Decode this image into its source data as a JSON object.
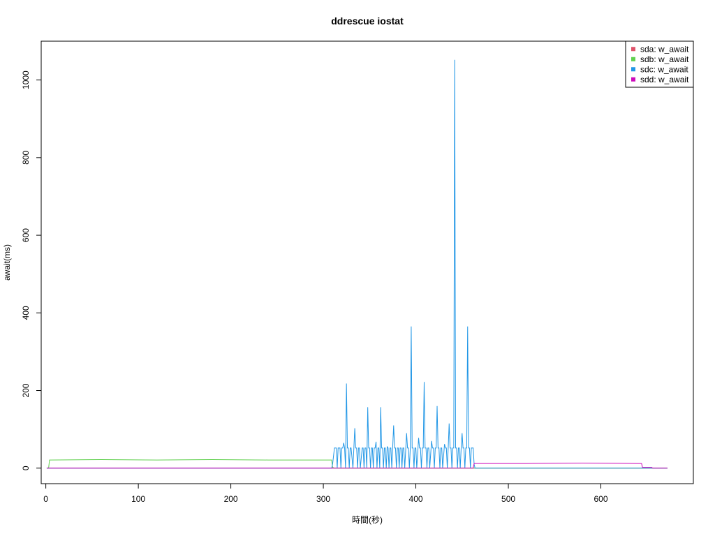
{
  "chart_data": {
    "type": "line",
    "title": "ddrescue iostat",
    "xlabel": "時間(秒)",
    "ylabel": "await(ms)",
    "xlim": [
      -5,
      700
    ],
    "ylim": [
      -40,
      1100
    ],
    "xticks": [
      0,
      100,
      200,
      300,
      400,
      500,
      600
    ],
    "yticks": [
      0,
      200,
      400,
      600,
      800,
      1000
    ],
    "grid": false,
    "legend_position": "top-right",
    "series": [
      {
        "name": "sda: w_await",
        "color": "#df536b",
        "points": [
          [
            1,
            0
          ],
          [
            672,
            0
          ]
        ]
      },
      {
        "name": "sdb: w_await",
        "color": "#61d04f",
        "points": [
          [
            1,
            0
          ],
          [
            3,
            0
          ],
          [
            4,
            21
          ],
          [
            60,
            22
          ],
          [
            120,
            21
          ],
          [
            180,
            22
          ],
          [
            240,
            21
          ],
          [
            309,
            21
          ],
          [
            310,
            2
          ],
          [
            312,
            0
          ],
          [
            672,
            0
          ]
        ]
      },
      {
        "name": "sdc: w_await",
        "color": "#2297e6",
        "points": [
          [
            1,
            0
          ],
          [
            309,
            0
          ],
          [
            310,
            10
          ],
          [
            312,
            52
          ],
          [
            314,
            52
          ],
          [
            315,
            0
          ],
          [
            316,
            52
          ],
          [
            318,
            52
          ],
          [
            319,
            0
          ],
          [
            320,
            52
          ],
          [
            321,
            52
          ],
          [
            322,
            65
          ],
          [
            323,
            52
          ],
          [
            324,
            0
          ],
          [
            325,
            218
          ],
          [
            326,
            52
          ],
          [
            327,
            52
          ],
          [
            328,
            0
          ],
          [
            329,
            52
          ],
          [
            330,
            52
          ],
          [
            332,
            0
          ],
          [
            334,
            103
          ],
          [
            335,
            52
          ],
          [
            336,
            52
          ],
          [
            337,
            0
          ],
          [
            338,
            52
          ],
          [
            339,
            52
          ],
          [
            340,
            0
          ],
          [
            342,
            52
          ],
          [
            343,
            52
          ],
          [
            344,
            0
          ],
          [
            345,
            52
          ],
          [
            346,
            52
          ],
          [
            347,
            0
          ],
          [
            348,
            157
          ],
          [
            349,
            52
          ],
          [
            350,
            52
          ],
          [
            351,
            0
          ],
          [
            352,
            52
          ],
          [
            353,
            52
          ],
          [
            354,
            0
          ],
          [
            355,
            52
          ],
          [
            356,
            52
          ],
          [
            357,
            68
          ],
          [
            358,
            0
          ],
          [
            359,
            52
          ],
          [
            360,
            52
          ],
          [
            361,
            0
          ],
          [
            362,
            157
          ],
          [
            363,
            52
          ],
          [
            364,
            52
          ],
          [
            365,
            0
          ],
          [
            366,
            52
          ],
          [
            367,
            52
          ],
          [
            368,
            0
          ],
          [
            369,
            55
          ],
          [
            370,
            52
          ],
          [
            371,
            0
          ],
          [
            372,
            52
          ],
          [
            373,
            52
          ],
          [
            374,
            0
          ],
          [
            376,
            110
          ],
          [
            377,
            52
          ],
          [
            378,
            52
          ],
          [
            379,
            0
          ],
          [
            380,
            52
          ],
          [
            381,
            52
          ],
          [
            382,
            0
          ],
          [
            383,
            52
          ],
          [
            384,
            52
          ],
          [
            385,
            0
          ],
          [
            386,
            52
          ],
          [
            387,
            52
          ],
          [
            388,
            0
          ],
          [
            390,
            90
          ],
          [
            391,
            52
          ],
          [
            392,
            52
          ],
          [
            393,
            0
          ],
          [
            394,
            52
          ],
          [
            395,
            365
          ],
          [
            396,
            52
          ],
          [
            397,
            52
          ],
          [
            398,
            0
          ],
          [
            399,
            52
          ],
          [
            400,
            52
          ],
          [
            401,
            0
          ],
          [
            403,
            78
          ],
          [
            404,
            52
          ],
          [
            405,
            52
          ],
          [
            406,
            0
          ],
          [
            407,
            52
          ],
          [
            408,
            52
          ],
          [
            409,
            222
          ],
          [
            410,
            52
          ],
          [
            411,
            52
          ],
          [
            412,
            0
          ],
          [
            413,
            52
          ],
          [
            414,
            52
          ],
          [
            415,
            0
          ],
          [
            417,
            70
          ],
          [
            418,
            52
          ],
          [
            419,
            52
          ],
          [
            420,
            0
          ],
          [
            421,
            52
          ],
          [
            422,
            52
          ],
          [
            423,
            160
          ],
          [
            424,
            52
          ],
          [
            425,
            52
          ],
          [
            426,
            0
          ],
          [
            427,
            52
          ],
          [
            428,
            52
          ],
          [
            429,
            0
          ],
          [
            431,
            62
          ],
          [
            432,
            52
          ],
          [
            433,
            52
          ],
          [
            434,
            0
          ],
          [
            435,
            52
          ],
          [
            436,
            115
          ],
          [
            437,
            52
          ],
          [
            438,
            52
          ],
          [
            439,
            0
          ],
          [
            440,
            52
          ],
          [
            441,
            52
          ],
          [
            442,
            1052
          ],
          [
            443,
            52
          ],
          [
            444,
            52
          ],
          [
            445,
            0
          ],
          [
            446,
            52
          ],
          [
            447,
            52
          ],
          [
            448,
            0
          ],
          [
            449,
            52
          ],
          [
            450,
            90
          ],
          [
            451,
            52
          ],
          [
            452,
            52
          ],
          [
            453,
            0
          ],
          [
            454,
            52
          ],
          [
            455,
            52
          ],
          [
            456,
            365
          ],
          [
            457,
            52
          ],
          [
            458,
            52
          ],
          [
            459,
            0
          ],
          [
            460,
            52
          ],
          [
            461,
            52
          ],
          [
            462,
            52
          ],
          [
            463,
            10
          ],
          [
            464,
            0
          ],
          [
            672,
            0
          ]
        ]
      },
      {
        "name": "sdd: w_await",
        "color": "#cd0bbc",
        "points": [
          [
            1,
            0
          ],
          [
            462,
            0
          ],
          [
            463,
            12
          ],
          [
            520,
            12
          ],
          [
            580,
            13
          ],
          [
            640,
            12
          ],
          [
            644,
            12
          ],
          [
            645,
            2
          ],
          [
            655,
            2
          ],
          [
            656,
            0
          ],
          [
            672,
            0
          ]
        ]
      }
    ]
  }
}
